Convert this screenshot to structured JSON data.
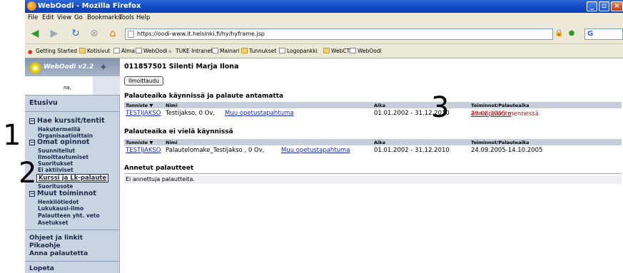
{
  "window": {
    "title": "WebOodi - Mozilla Firefox"
  },
  "menu": [
    "File",
    "Edit",
    "View",
    "Go",
    "Bookmarks",
    "Tools",
    "Help"
  ],
  "url": "https://oodi-www.it.helsinki.fi/hy/hyframe.jsp",
  "search_engine": "G",
  "bookmarks": [
    "Getting Started",
    "Kotisivut",
    "Alma",
    "WebOodi",
    "TUKE Intranet",
    "Mainari",
    "Tunnukset",
    "Logopankki",
    "WebCT",
    "WebOodi"
  ],
  "sidebar": {
    "logo": "WebOodi v2.2",
    "user": "na,",
    "etusivu": "Etusivu",
    "group1": {
      "label": "Hae kurssit/tentit",
      "items": [
        "Hakutermeillä",
        "Organisaatioittain"
      ]
    },
    "group2": {
      "label": "Omat opinnot",
      "items": [
        "Suunnitellut",
        "Ilmoittautumiset",
        "Suoritukset",
        "Ei aktiiviset",
        "Kurssi ja Lk-palaute",
        "Suoritusote"
      ]
    },
    "group3": {
      "label": "Muut toiminnot",
      "items": [
        "Henkilötiedot",
        "Lukukausi-ilmo",
        "Palautteen yht. veto",
        "Asetukset"
      ]
    },
    "bottom": [
      "Ohjeet ja linkit",
      "Pikaohje",
      "Anna palautetta"
    ],
    "logout": "Lopeta"
  },
  "main": {
    "header": "011857501 Silenti Marja Ilona",
    "button": "Ilmoittaudu",
    "cols": {
      "code": "Tunniste ▼",
      "name": "Nimi",
      "time": "Aika",
      "actions": "Toiminnot/Palauteaika"
    },
    "sec1": {
      "title": "Palauteaika käynnissä ja palaute antamatta",
      "row": {
        "code": "TESTIJAKSO",
        "name": "Testijakso, 0 Ov,",
        "link": "Muu opetustapahtuma",
        "time": "01.01.2002 - 31.12.2010",
        "action_link": "Anna palaute",
        "action_rest": " 29.08.2005 mennessä"
      }
    },
    "sec2": {
      "title": "Palauteaika ei vielä käynnissä",
      "row": {
        "code": "TESTIJAKSO",
        "name": "Palautelomake_Testijakso , 0 Ov,",
        "link": "Muu opetustapahtuma",
        "time": "01.01.2002 - 31.12.2010",
        "action": "24.09.2005-14.10.2005"
      }
    },
    "sec3": {
      "title": "Annetut palautteet",
      "empty": "Ei annettuja palautteita."
    }
  },
  "annotations": [
    "1",
    "2",
    "3"
  ]
}
